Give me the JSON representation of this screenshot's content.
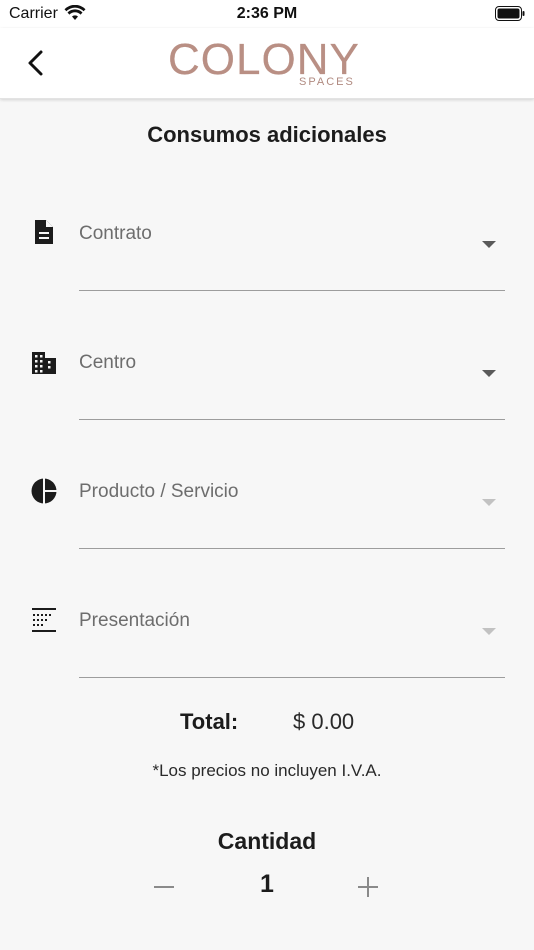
{
  "status_bar": {
    "carrier": "Carrier",
    "time": "2:36 PM"
  },
  "header": {
    "logo_main": "COLONY",
    "logo_sub": "SPACES"
  },
  "page": {
    "title": "Consumos adicionales"
  },
  "fields": [
    {
      "label": "Contrato",
      "icon": "document-icon",
      "enabled": true
    },
    {
      "label": "Centro",
      "icon": "building-icon",
      "enabled": true
    },
    {
      "label": "Producto / Servicio",
      "icon": "pie-chart-icon",
      "enabled": false
    },
    {
      "label": "Presentación",
      "icon": "list-grid-icon",
      "enabled": false
    }
  ],
  "total": {
    "label": "Total:",
    "value": "$ 0.00"
  },
  "note": "*Los precios no incluyen I.V.A.",
  "quantity": {
    "title": "Cantidad",
    "value": "1"
  },
  "colors": {
    "accent": "#b98f84",
    "text": "#1c1c1c",
    "muted": "#6d6d6d",
    "background": "#f7f7f7"
  }
}
